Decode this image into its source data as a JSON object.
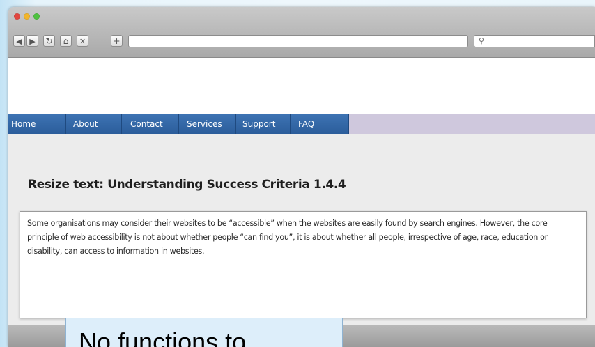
{
  "browser": {
    "traffic_lights": [
      {
        "name": "close",
        "color": "#e2463f"
      },
      {
        "name": "minimize",
        "color": "#f2b52a"
      },
      {
        "name": "maximize",
        "color": "#4fc240"
      }
    ],
    "toolbar": {
      "back_icon": "◀",
      "forward_icon": "▶",
      "reload_icon": "↻",
      "home_icon": "⌂",
      "stop_icon": "✕",
      "new_tab_label": "+",
      "address_value": "",
      "search_icon": "⚲"
    }
  },
  "site": {
    "nav": {
      "items": [
        {
          "label": "Home"
        },
        {
          "label": "About"
        },
        {
          "label": "Contact"
        },
        {
          "label": "Services"
        },
        {
          "label": "Support"
        },
        {
          "label": "FAQ"
        }
      ],
      "menu_color": "#2f64a6",
      "bar_color": "#cfc8dd"
    },
    "heading": "Resize text: Understanding Success Criteria 1.4.4",
    "paragraph": "Some organisations may consider their websites to be “accessible” when the websites are easily found by search engines. However, the core principle of web accessibility is not about whether people “can find you”, it is about whether all people, irrespective of age, race, education or disability, can access to information in websites."
  },
  "caption": {
    "text": "No functions to"
  }
}
